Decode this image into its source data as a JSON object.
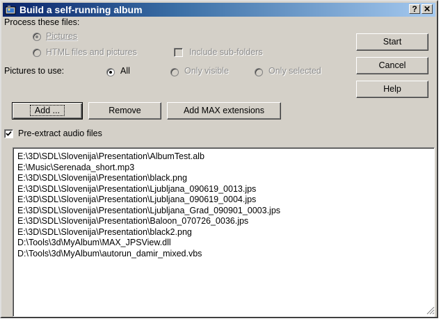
{
  "window": {
    "title": "Build a self-running album",
    "help_button_label": "?",
    "close_button_label": "✕"
  },
  "process": {
    "label": "Process these files:",
    "option_pictures": "Pictures",
    "option_html": "HTML files and pictures",
    "include_subfolders": "Include sub-folders"
  },
  "pictures_to_use": {
    "label": "Pictures to use:",
    "option_all": "All",
    "option_visible": "Only visible",
    "option_selected": "Only selected",
    "selected": "All"
  },
  "buttons": {
    "add": "Add ...",
    "remove": "Remove",
    "add_max": "Add MAX extensions",
    "start": "Start",
    "cancel": "Cancel",
    "help": "Help"
  },
  "pre_extract": {
    "label": "Pre-extract audio files",
    "checked": true
  },
  "files": [
    "E:\\3D\\SDL\\Slovenija\\Presentation\\AlbumTest.alb",
    "E:\\Music\\Serenada_short.mp3",
    "E:\\3D\\SDL\\Slovenija\\Presentation\\black.png",
    "E:\\3D\\SDL\\Slovenija\\Presentation\\Ljubljana_090619_0013.jps",
    "E:\\3D\\SDL\\Slovenija\\Presentation\\Ljubljana_090619_0004.jps",
    "E:\\3D\\SDL\\Slovenija\\Presentation\\Ljubljana_Grad_090901_0003.jps",
    "E:\\3D\\SDL\\Slovenija\\Presentation\\Baloon_070726_0036.jps",
    "E:\\3D\\SDL\\Slovenija\\Presentation\\black2.png",
    "D:\\Tools\\3d\\MyAlbum\\MAX_JPSView.dll",
    "D:\\Tools\\3d\\MyAlbum\\autorun_damir_mixed.vbs"
  ]
}
